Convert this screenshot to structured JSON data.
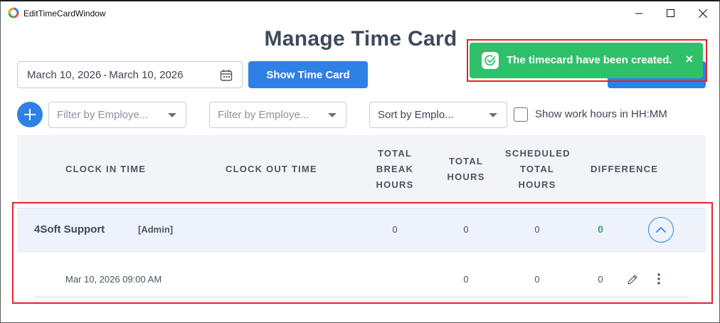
{
  "window": {
    "title": "EditTimeCardWindow",
    "controls": {
      "minimize": "—",
      "maximize": "☐",
      "close": "✕"
    }
  },
  "page": {
    "title": "Manage Time Card"
  },
  "date_range": {
    "start": "March 10, 2026",
    "separator": "-",
    "end": "March 10, 2026",
    "icon": "calendar-icon"
  },
  "buttons": {
    "show_time_card": "Show Time Card",
    "add": "+"
  },
  "toast": {
    "message": "The timecard have been created.",
    "close": "×",
    "icon": "check-circle-icon",
    "color": "#2ec16a"
  },
  "filters": {
    "employee_filter_1": "Filter by Employe...",
    "employee_filter_2": "Filter by Employe...",
    "sort": "Sort by Emplo...",
    "hhmm_checkbox_label": "Show work hours in HH:MM",
    "hhmm_checked": false
  },
  "table": {
    "headers": {
      "clock_in": "CLOCK IN TIME",
      "clock_out": "CLOCK OUT TIME",
      "break_hours_1": "TOTAL",
      "break_hours_2": "BREAK",
      "break_hours_3": "HOURS",
      "total_hours_1": "TOTAL",
      "total_hours_2": "HOURS",
      "scheduled_1": "SCHEDULED",
      "scheduled_2": "TOTAL",
      "scheduled_3": "HOURS",
      "difference": "DIFFERENCE"
    },
    "employee": {
      "name": "4Soft Support",
      "role": "[Admin]",
      "break_hours": "0",
      "total_hours": "0",
      "scheduled_hours": "0",
      "difference": "0"
    },
    "entry": {
      "clock_in": "Mar 10, 2026 09:00 AM",
      "total_hours": "0",
      "scheduled_hours": "0",
      "difference": "0"
    }
  },
  "colors": {
    "accent": "#2f80e4",
    "highlight_border": "#e0262f",
    "positive": "#27ae60"
  }
}
